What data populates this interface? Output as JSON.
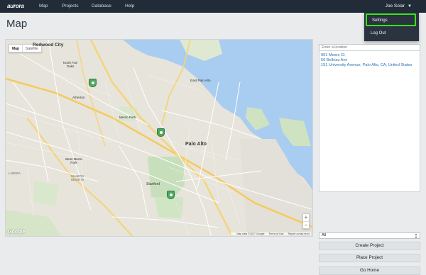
{
  "brand": "aurora",
  "nav": {
    "items": [
      "Map",
      "Projects",
      "Database",
      "Help"
    ]
  },
  "user": {
    "name": "Joe Solar"
  },
  "dropdown": {
    "items": [
      "Settings",
      "Log Out"
    ]
  },
  "page": {
    "title": "Map"
  },
  "map": {
    "type_active": "Map",
    "type_other": "Satellite",
    "labels": [
      "Redwood City",
      "North Fair Oaks",
      "Atherton",
      "Menlo Park",
      "East Palo Alto",
      "Palo Alto",
      "West Menlo Park",
      "Stanford",
      "SHARON HEIGHTS",
      "LADERA"
    ],
    "zoom_in": "+",
    "zoom_out": "−",
    "attribution": [
      "Map data ©2017 Google",
      "Terms of Use",
      "Report a map error"
    ],
    "logo": "Google"
  },
  "side": {
    "search_placeholder": "Enter a location",
    "addresses": [
      "901 Mears Ct",
      "56 Belleau Ave",
      "151 University Avenue, Palo Alto, CA, United States"
    ],
    "filter": "All",
    "buttons": {
      "create": "Create Project",
      "place": "Place Project",
      "home": "Go Home"
    }
  }
}
